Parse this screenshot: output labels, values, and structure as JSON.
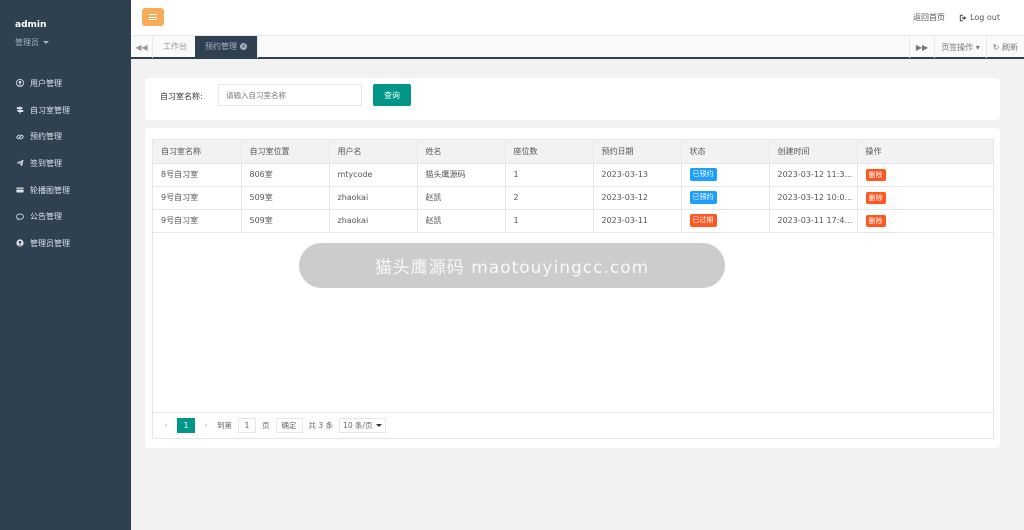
{
  "sidebar": {
    "username": "admin",
    "role": "管理员",
    "items": [
      {
        "label": "用户管理",
        "icon": "user-circle-icon"
      },
      {
        "label": "自习室管理",
        "icon": "signpost-icon"
      },
      {
        "label": "预约管理",
        "icon": "link-icon"
      },
      {
        "label": "签到管理",
        "icon": "paper-plane-icon"
      },
      {
        "label": "轮播图管理",
        "icon": "credit-card-icon"
      },
      {
        "label": "公告管理",
        "icon": "comment-icon"
      },
      {
        "label": "管理员管理",
        "icon": "user-shield-icon"
      }
    ]
  },
  "topbar": {
    "back_home": "返回首页",
    "logout": "Log out"
  },
  "tabs": {
    "items": [
      {
        "label": "工作台"
      },
      {
        "label": "预约管理"
      }
    ],
    "tab_ops": "页签操作",
    "refresh": "刷新"
  },
  "search": {
    "label": "自习室名称:",
    "placeholder": "请输入自习室名称",
    "button": "查询"
  },
  "table": {
    "headers": [
      "自习室名称",
      "自习室位置",
      "用户名",
      "姓名",
      "座位数",
      "预约日期",
      "状态",
      "创建时间",
      "操作"
    ],
    "rows": [
      {
        "room": "8号自习室",
        "location": "806室",
        "username": "mtycode",
        "name": "猫头鹰源码",
        "seats": "1",
        "date": "2023-03-13",
        "status": "已预约",
        "status_color": "#1e9fff",
        "created": "2023-03-12 11:3...",
        "action": "删除"
      },
      {
        "room": "9号自习室",
        "location": "509室",
        "username": "zhaokai",
        "name": "赵凯",
        "seats": "2",
        "date": "2023-03-12",
        "status": "已预约",
        "status_color": "#1e9fff",
        "created": "2023-03-12 10:0...",
        "action": "删除"
      },
      {
        "room": "9号自习室",
        "location": "509室",
        "username": "zhaokai",
        "name": "赵凯",
        "seats": "1",
        "date": "2023-03-11",
        "status": "已过期",
        "status_color": "#ff5722",
        "created": "2023-03-11 17:4...",
        "action": "删除"
      }
    ]
  },
  "pager": {
    "current": "1",
    "goto_label": "到第",
    "goto_value": "1",
    "page_unit": "页",
    "ok": "确定",
    "total": "共 3 条",
    "per_page": "10 条/页"
  },
  "toast": "猫头鹰源码 maotouyingcc.com",
  "colors": {
    "sidebar": "#2f4050",
    "accent": "#009688",
    "menu_btn": "#f8ac59",
    "danger": "#ff5722",
    "info": "#1e9fff"
  }
}
